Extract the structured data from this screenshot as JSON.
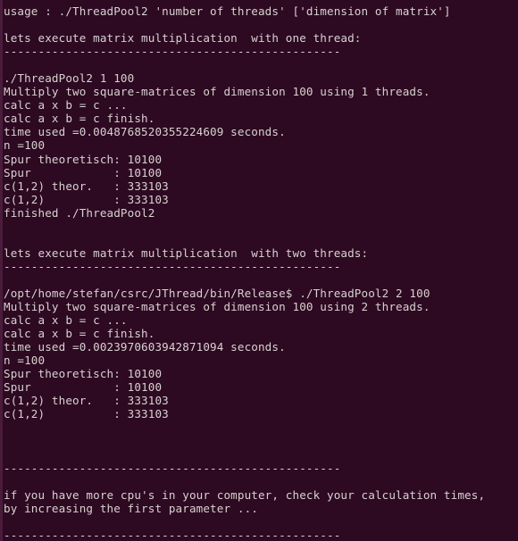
{
  "terminal": {
    "background_color": "#2d0922",
    "foreground_color": "#d8d2d0",
    "scrollbar_color": "#4a1c3c",
    "columns": 67,
    "rows": 40,
    "separator": "-------------------------------------------------",
    "lines": [
      "usage : ./ThreadPool2 'number of threads' ['dimension of matrix']",
      "",
      "lets execute matrix multiplication  with one thread:",
      "-------------------------------------------------",
      "",
      "./ThreadPool2 1 100",
      "Multiply two square-matrices of dimension 100 using 1 threads.",
      "calc a x b = c ...",
      "calc a x b = c finish.",
      "time used =0.0048768520355224609 seconds.",
      "n =100",
      "Spur theoretisch: 10100",
      "Spur            : 10100",
      "c(1,2) theor.   : 333103",
      "c(1,2)          : 333103",
      "finished ./ThreadPool2",
      "",
      "",
      "lets execute matrix multiplication  with two threads:",
      "-------------------------------------------------",
      "",
      "/opt/home/stefan/csrc/JThread/bin/Release$ ./ThreadPool2 2 100",
      "Multiply two square-matrices of dimension 100 using 2 threads.",
      "calc a x b = c ...",
      "calc a x b = c finish.",
      "time used =0.0023970603942871094 seconds.",
      "n =100",
      "Spur theoretisch: 10100",
      "Spur            : 10100",
      "c(1,2) theor.   : 333103",
      "c(1,2)          : 333103",
      "",
      "",
      "",
      "-------------------------------------------------",
      "",
      "if you have more cpu's in your computer, check your calculation times,",
      "by increasing the first parameter ...",
      "",
      "-------------------------------------------------"
    ]
  }
}
